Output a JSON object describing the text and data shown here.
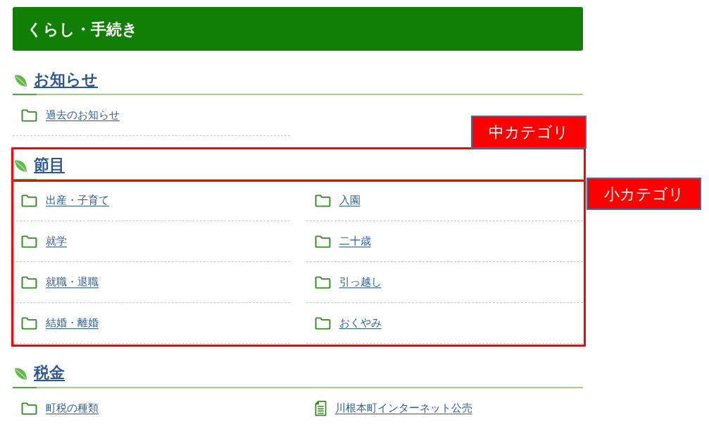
{
  "page_title": "くらし・手続き",
  "sections": [
    {
      "title": "お知らせ",
      "items": [
        {
          "label": "過去のお知らせ",
          "kind": "folder"
        }
      ]
    },
    {
      "title": "節目",
      "items": [
        {
          "label": "出産・子育て",
          "kind": "folder"
        },
        {
          "label": "入園",
          "kind": "folder"
        },
        {
          "label": "就学",
          "kind": "folder"
        },
        {
          "label": "二十歳",
          "kind": "folder"
        },
        {
          "label": "就職・退職",
          "kind": "folder"
        },
        {
          "label": "引っ越し",
          "kind": "folder"
        },
        {
          "label": "結婚・離婚",
          "kind": "folder"
        },
        {
          "label": "おくやみ",
          "kind": "folder"
        }
      ],
      "callouts": [
        {
          "kind": "heading",
          "label": "中カテゴリ"
        },
        {
          "kind": "items",
          "label": "小カテゴリ"
        }
      ]
    },
    {
      "title": "税金",
      "items": [
        {
          "label": "町税の種類",
          "kind": "folder"
        },
        {
          "label": "川根本町インターネット公売",
          "kind": "page"
        }
      ]
    }
  ]
}
